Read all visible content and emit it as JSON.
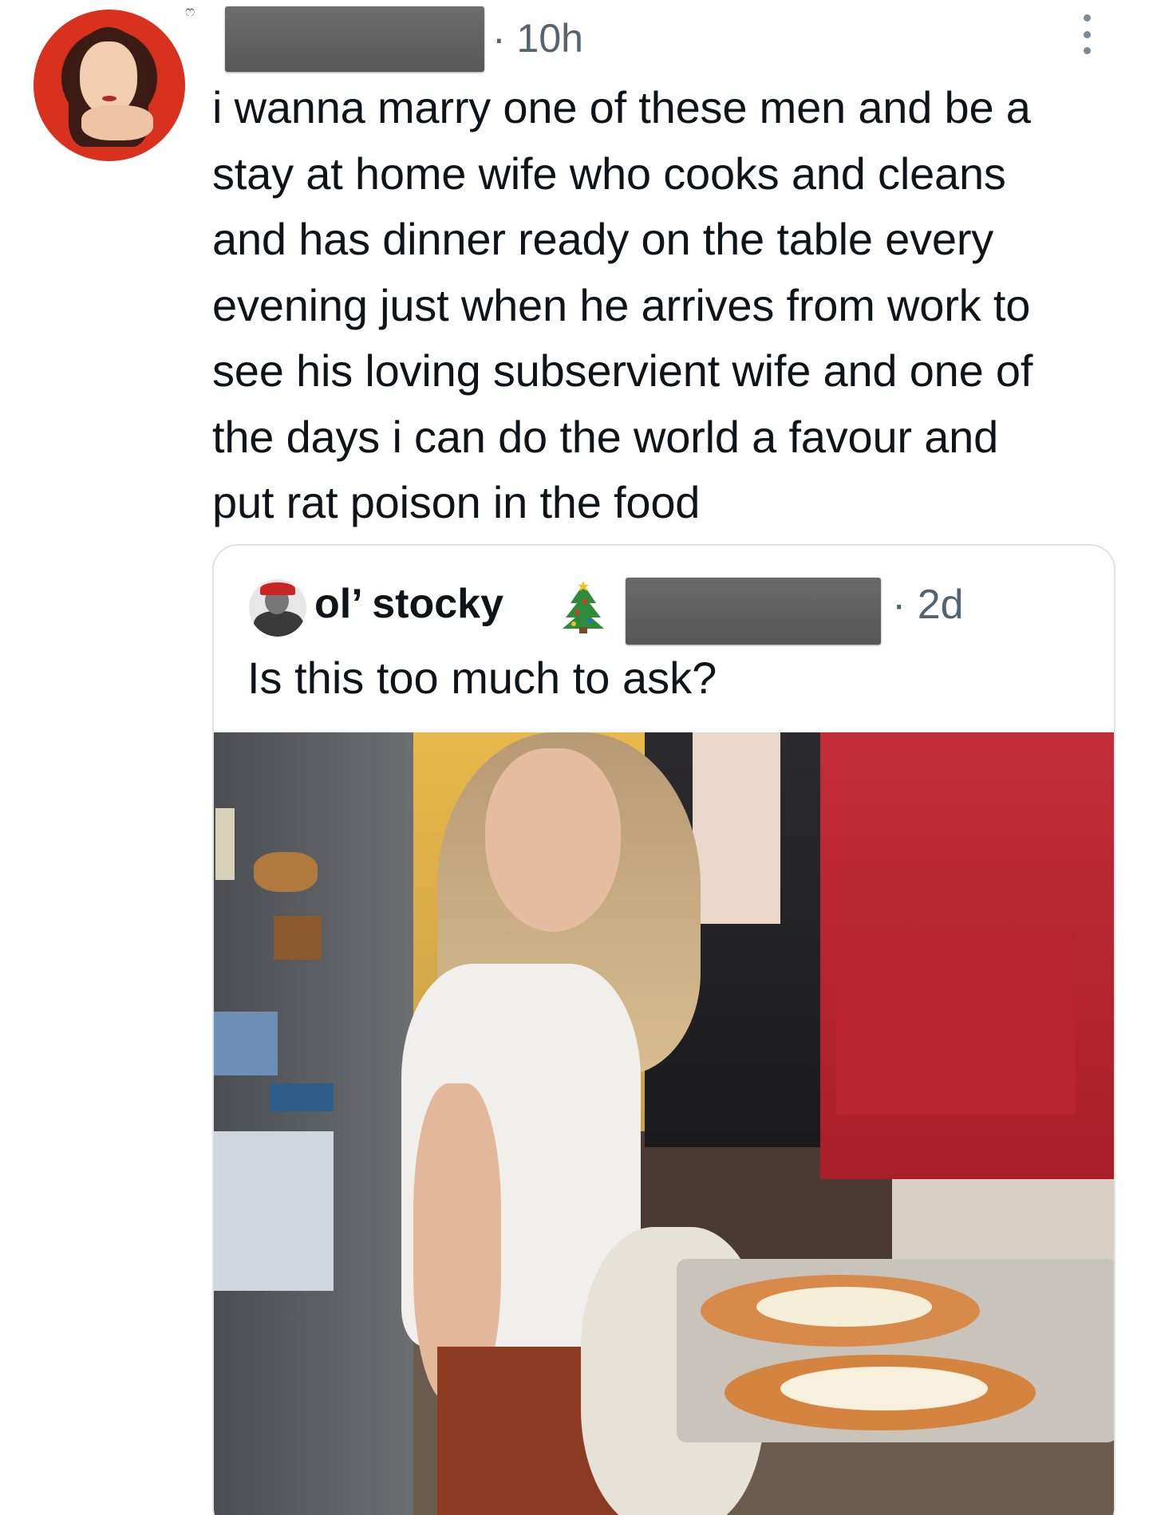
{
  "tweet": {
    "mark": "ෆ",
    "time": "· 10h",
    "text_lines": [
      "i wanna marry one of these men and be a",
      "stay at home wife who cooks and cleans",
      "and has dinner ready on the table every",
      "evening just when he arrives from work to",
      "see his loving subservient wife and one of",
      "the days i can do the world a favour and",
      "put rat poison in the food"
    ]
  },
  "quote": {
    "name": "ol’ stocky",
    "time": "· 2d",
    "text": "Is this too much to ask?"
  },
  "icons": {
    "more": "more-dots-icon",
    "tree": "christmas-tree-emoji"
  }
}
